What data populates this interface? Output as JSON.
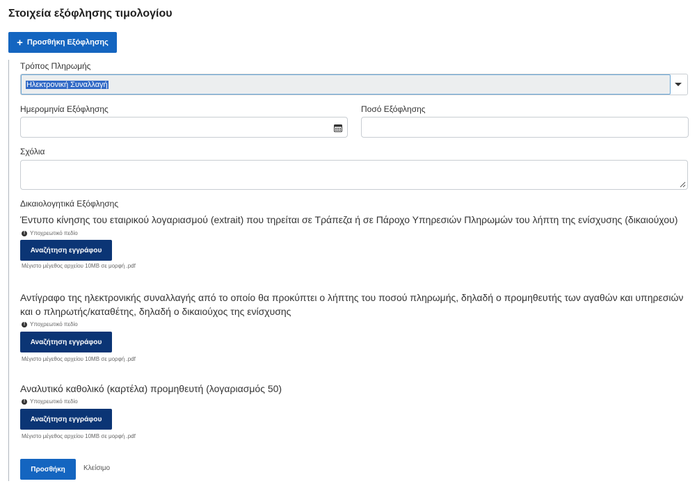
{
  "header": {
    "title": "Στοιχεία εξόφλησης τιμολογίου",
    "add_payment_label": "Προσθήκη Εξόφλησης",
    "add_payment_icon": "plus-icon"
  },
  "form": {
    "payment_method": {
      "label": "Τρόπος Πληρωμής",
      "selected_value": "Ηλεκτρονική Συναλλαγή",
      "caret_icon": "caret-down-icon"
    },
    "payment_date": {
      "label": "Ημερομηνία Εξόφλησης",
      "value": "",
      "icon": "calendar-icon"
    },
    "payment_amount": {
      "label": "Ποσό Εξόφλησης",
      "value": ""
    },
    "comments": {
      "label": "Σχόλια",
      "value": ""
    },
    "documents_heading": "Δικαιολογητικά Εξόφλησης",
    "documents": [
      {
        "description": "Έντυπο κίνησης του εταιρικού λογαριασμού (extrait) που τηρείται σε Τράπεζα ή σε Πάροχο Υπηρεσιών Πληρωμών του λήπτη της ενίσχυσης (δικαιούχου)",
        "required_note": "Υποχρεωτικό πεδίο",
        "button_label": "Αναζήτηση εγγράφου",
        "size_hint": "Μέγιστο μέγεθος αρχείου 10MB σε μορφή .pdf"
      },
      {
        "description": "Αντίγραφο της ηλεκτρονικής συναλλαγής από το οποίο θα προκύπτει ο λήπτης του ποσού πληρωμής, δηλαδή ο προμηθευτής των αγαθών και υπηρεσιών και ο πληρωτής/καταθέτης, δηλαδή ο δικαιούχος της ενίσχυσης",
        "required_note": "Υποχρεωτικό πεδίο",
        "button_label": "Αναζήτηση εγγράφου",
        "size_hint": "Μέγιστο μέγεθος αρχείου 10MB σε μορφή .pdf"
      },
      {
        "description": "Αναλυτικό καθολικό (καρτέλα) προμηθευτή (λογαριασμός 50)",
        "required_note": "Υποχρεωτικό πεδίο",
        "button_label": "Αναζήτηση εγγράφου",
        "size_hint": "Μέγιστο μέγεθος αρχείου 10MB σε μορφή .pdf"
      }
    ],
    "submit_label": "Προσθήκη",
    "close_label": "Κλείσιμο"
  },
  "colors": {
    "primary_button": "#1465c0",
    "dark_button": "#0b3575",
    "selection_highlight": "#3169c6"
  }
}
